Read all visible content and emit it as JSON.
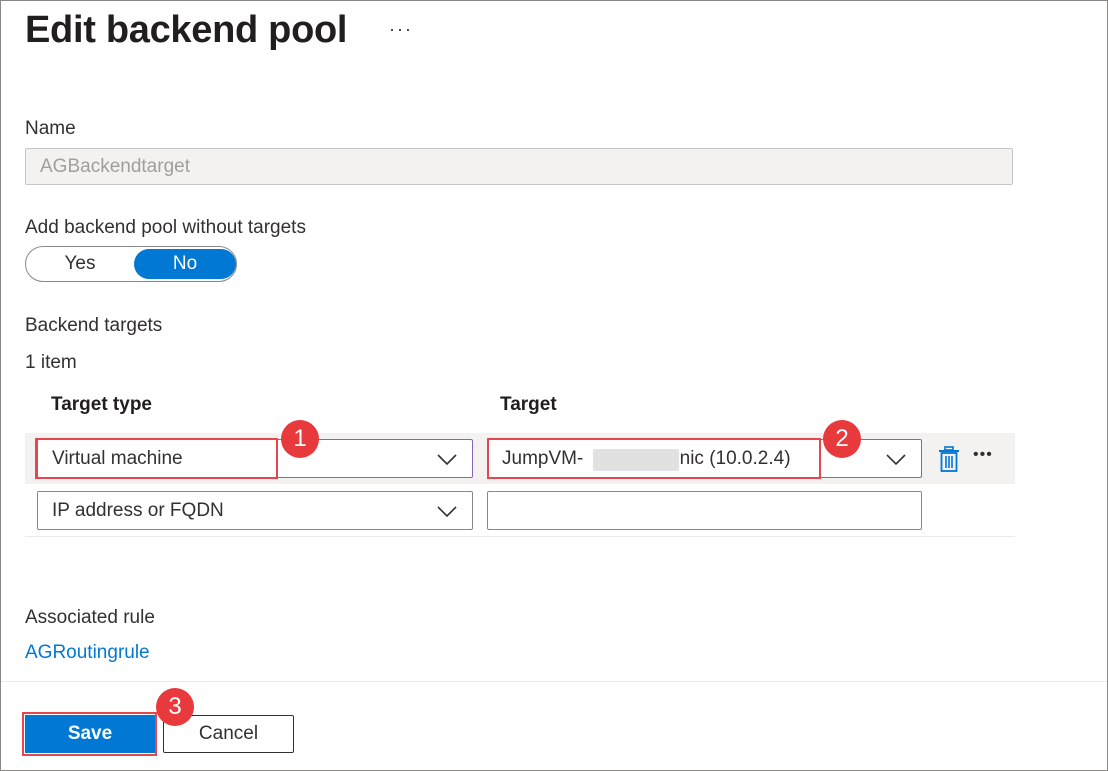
{
  "header": {
    "title": "Edit backend pool",
    "more_label": "···"
  },
  "form": {
    "name_label": "Name",
    "name_value": "AGBackendtarget",
    "without_targets_label": "Add backend pool without targets",
    "toggle": {
      "yes_label": "Yes",
      "no_label": "No",
      "selected": "No"
    },
    "backend_targets_label": "Backend targets",
    "item_count": "1 item",
    "columns": {
      "target_type": "Target type",
      "target": "Target"
    },
    "rows": [
      {
        "target_type": "Virtual machine",
        "target_prefix": "JumpVM-",
        "target_suffix": "-nic (10.0.2.4)"
      },
      {
        "target_type": "IP address or FQDN",
        "target_prefix": "",
        "target_suffix": ""
      }
    ],
    "row_more_label": "•••",
    "associated_rule_label": "Associated rule",
    "associated_rule_link": "AGRoutingrule"
  },
  "footer": {
    "save_label": "Save",
    "cancel_label": "Cancel"
  },
  "annotations": {
    "badge1": "1",
    "badge2": "2",
    "badge3": "3"
  },
  "colors": {
    "accent": "#0078d4",
    "highlight": "#e8464f",
    "badge": "#e8393c",
    "focus_border": "#8764b8"
  },
  "icons": {
    "chevron": "chevron-down-icon",
    "delete": "trash-icon",
    "more": "more-icon"
  }
}
